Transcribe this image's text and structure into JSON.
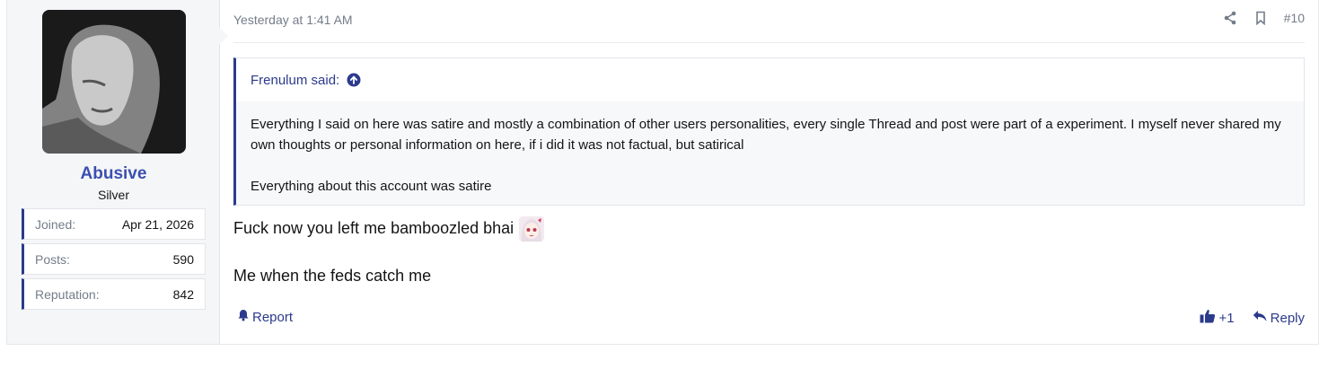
{
  "user": {
    "name": "Abusive",
    "title": "Silver",
    "stats": [
      {
        "label": "Joined:",
        "value": "Apr 21, 2026"
      },
      {
        "label": "Posts:",
        "value": "590"
      },
      {
        "label": "Reputation:",
        "value": "842"
      }
    ]
  },
  "post": {
    "date": "Yesterday at 1:41 AM",
    "number": "#10",
    "quote": {
      "author_line": "Frenulum said:",
      "paragraphs": [
        "Everything I said on here was satire and mostly a combination of other users personalities, every single Thread and post were part of a experiment. I myself never shared my own thoughts or personal information on here, if i did it was not factual, but satirical",
        "Everything about this account was satire"
      ]
    },
    "content": {
      "line1": "Fuck now you left me bamboozled bhai",
      "line2": "Me when the feds catch me"
    },
    "actions": {
      "report": "Report",
      "reaction_count": "+1",
      "reply": "Reply"
    }
  },
  "colors": {
    "accent": "#2b3a8c",
    "username": "#3b4fb0",
    "muted": "#747d8a"
  }
}
